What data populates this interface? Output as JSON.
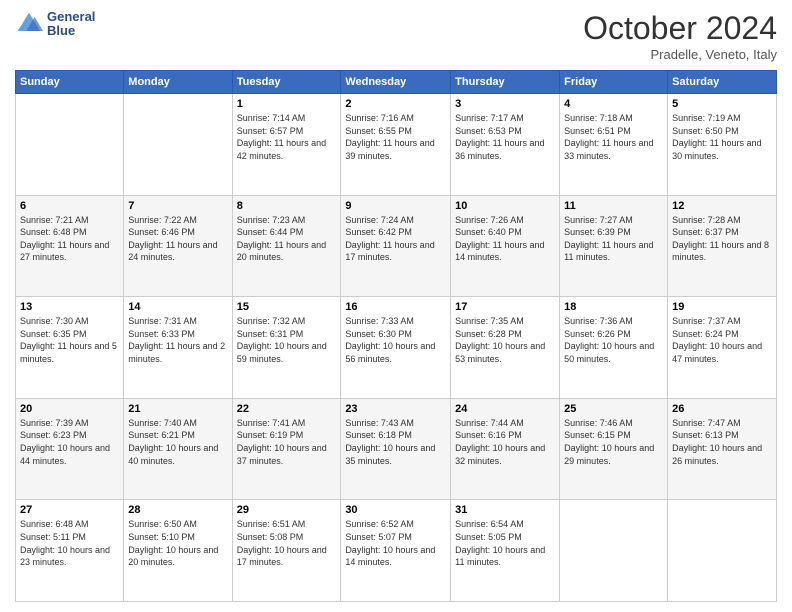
{
  "header": {
    "logo_line1": "General",
    "logo_line2": "Blue",
    "month": "October 2024",
    "location": "Pradelle, Veneto, Italy"
  },
  "days_of_week": [
    "Sunday",
    "Monday",
    "Tuesday",
    "Wednesday",
    "Thursday",
    "Friday",
    "Saturday"
  ],
  "weeks": [
    [
      {
        "num": "",
        "sunrise": "",
        "sunset": "",
        "daylight": ""
      },
      {
        "num": "",
        "sunrise": "",
        "sunset": "",
        "daylight": ""
      },
      {
        "num": "1",
        "sunrise": "Sunrise: 7:14 AM",
        "sunset": "Sunset: 6:57 PM",
        "daylight": "Daylight: 11 hours and 42 minutes."
      },
      {
        "num": "2",
        "sunrise": "Sunrise: 7:16 AM",
        "sunset": "Sunset: 6:55 PM",
        "daylight": "Daylight: 11 hours and 39 minutes."
      },
      {
        "num": "3",
        "sunrise": "Sunrise: 7:17 AM",
        "sunset": "Sunset: 6:53 PM",
        "daylight": "Daylight: 11 hours and 36 minutes."
      },
      {
        "num": "4",
        "sunrise": "Sunrise: 7:18 AM",
        "sunset": "Sunset: 6:51 PM",
        "daylight": "Daylight: 11 hours and 33 minutes."
      },
      {
        "num": "5",
        "sunrise": "Sunrise: 7:19 AM",
        "sunset": "Sunset: 6:50 PM",
        "daylight": "Daylight: 11 hours and 30 minutes."
      }
    ],
    [
      {
        "num": "6",
        "sunrise": "Sunrise: 7:21 AM",
        "sunset": "Sunset: 6:48 PM",
        "daylight": "Daylight: 11 hours and 27 minutes."
      },
      {
        "num": "7",
        "sunrise": "Sunrise: 7:22 AM",
        "sunset": "Sunset: 6:46 PM",
        "daylight": "Daylight: 11 hours and 24 minutes."
      },
      {
        "num": "8",
        "sunrise": "Sunrise: 7:23 AM",
        "sunset": "Sunset: 6:44 PM",
        "daylight": "Daylight: 11 hours and 20 minutes."
      },
      {
        "num": "9",
        "sunrise": "Sunrise: 7:24 AM",
        "sunset": "Sunset: 6:42 PM",
        "daylight": "Daylight: 11 hours and 17 minutes."
      },
      {
        "num": "10",
        "sunrise": "Sunrise: 7:26 AM",
        "sunset": "Sunset: 6:40 PM",
        "daylight": "Daylight: 11 hours and 14 minutes."
      },
      {
        "num": "11",
        "sunrise": "Sunrise: 7:27 AM",
        "sunset": "Sunset: 6:39 PM",
        "daylight": "Daylight: 11 hours and 11 minutes."
      },
      {
        "num": "12",
        "sunrise": "Sunrise: 7:28 AM",
        "sunset": "Sunset: 6:37 PM",
        "daylight": "Daylight: 11 hours and 8 minutes."
      }
    ],
    [
      {
        "num": "13",
        "sunrise": "Sunrise: 7:30 AM",
        "sunset": "Sunset: 6:35 PM",
        "daylight": "Daylight: 11 hours and 5 minutes."
      },
      {
        "num": "14",
        "sunrise": "Sunrise: 7:31 AM",
        "sunset": "Sunset: 6:33 PM",
        "daylight": "Daylight: 11 hours and 2 minutes."
      },
      {
        "num": "15",
        "sunrise": "Sunrise: 7:32 AM",
        "sunset": "Sunset: 6:31 PM",
        "daylight": "Daylight: 10 hours and 59 minutes."
      },
      {
        "num": "16",
        "sunrise": "Sunrise: 7:33 AM",
        "sunset": "Sunset: 6:30 PM",
        "daylight": "Daylight: 10 hours and 56 minutes."
      },
      {
        "num": "17",
        "sunrise": "Sunrise: 7:35 AM",
        "sunset": "Sunset: 6:28 PM",
        "daylight": "Daylight: 10 hours and 53 minutes."
      },
      {
        "num": "18",
        "sunrise": "Sunrise: 7:36 AM",
        "sunset": "Sunset: 6:26 PM",
        "daylight": "Daylight: 10 hours and 50 minutes."
      },
      {
        "num": "19",
        "sunrise": "Sunrise: 7:37 AM",
        "sunset": "Sunset: 6:24 PM",
        "daylight": "Daylight: 10 hours and 47 minutes."
      }
    ],
    [
      {
        "num": "20",
        "sunrise": "Sunrise: 7:39 AM",
        "sunset": "Sunset: 6:23 PM",
        "daylight": "Daylight: 10 hours and 44 minutes."
      },
      {
        "num": "21",
        "sunrise": "Sunrise: 7:40 AM",
        "sunset": "Sunset: 6:21 PM",
        "daylight": "Daylight: 10 hours and 40 minutes."
      },
      {
        "num": "22",
        "sunrise": "Sunrise: 7:41 AM",
        "sunset": "Sunset: 6:19 PM",
        "daylight": "Daylight: 10 hours and 37 minutes."
      },
      {
        "num": "23",
        "sunrise": "Sunrise: 7:43 AM",
        "sunset": "Sunset: 6:18 PM",
        "daylight": "Daylight: 10 hours and 35 minutes."
      },
      {
        "num": "24",
        "sunrise": "Sunrise: 7:44 AM",
        "sunset": "Sunset: 6:16 PM",
        "daylight": "Daylight: 10 hours and 32 minutes."
      },
      {
        "num": "25",
        "sunrise": "Sunrise: 7:46 AM",
        "sunset": "Sunset: 6:15 PM",
        "daylight": "Daylight: 10 hours and 29 minutes."
      },
      {
        "num": "26",
        "sunrise": "Sunrise: 7:47 AM",
        "sunset": "Sunset: 6:13 PM",
        "daylight": "Daylight: 10 hours and 26 minutes."
      }
    ],
    [
      {
        "num": "27",
        "sunrise": "Sunrise: 6:48 AM",
        "sunset": "Sunset: 5:11 PM",
        "daylight": "Daylight: 10 hours and 23 minutes."
      },
      {
        "num": "28",
        "sunrise": "Sunrise: 6:50 AM",
        "sunset": "Sunset: 5:10 PM",
        "daylight": "Daylight: 10 hours and 20 minutes."
      },
      {
        "num": "29",
        "sunrise": "Sunrise: 6:51 AM",
        "sunset": "Sunset: 5:08 PM",
        "daylight": "Daylight: 10 hours and 17 minutes."
      },
      {
        "num": "30",
        "sunrise": "Sunrise: 6:52 AM",
        "sunset": "Sunset: 5:07 PM",
        "daylight": "Daylight: 10 hours and 14 minutes."
      },
      {
        "num": "31",
        "sunrise": "Sunrise: 6:54 AM",
        "sunset": "Sunset: 5:05 PM",
        "daylight": "Daylight: 10 hours and 11 minutes."
      },
      {
        "num": "",
        "sunrise": "",
        "sunset": "",
        "daylight": ""
      },
      {
        "num": "",
        "sunrise": "",
        "sunset": "",
        "daylight": ""
      }
    ]
  ]
}
